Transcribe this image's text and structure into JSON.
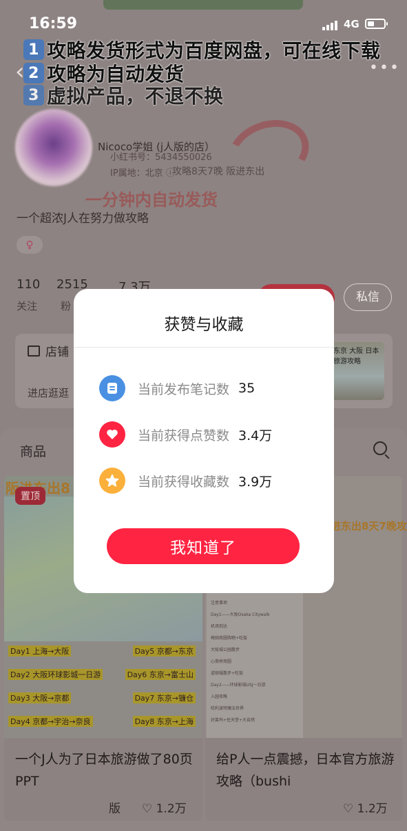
{
  "status_bar": {
    "time": "16:59",
    "network": "4G"
  },
  "promo_lines": [
    "攻略发货形式为百度网盘，可在线下载",
    "攻略为自动发货",
    "虚拟产品，不退不换"
  ],
  "promo_numbers": [
    "1",
    "2",
    "3"
  ],
  "profile": {
    "nickname": "Nicoco学姐 (j人版的店）",
    "red_id": "小红书号：5434550026",
    "ip": "IP属地：北京 ⓘ",
    "overlay_promo": "一分钟内自动发货",
    "overlay_mid": "攻略8天7晚 阪进东出",
    "bio": "一个超浓J人在努力做攻略",
    "gender_symbol": "♀",
    "stats": [
      {
        "value": "110",
        "label": "关注"
      },
      {
        "value": "2515",
        "label": "粉"
      },
      {
        "value": "7.3万",
        "label": ""
      }
    ],
    "message_button": "私信"
  },
  "shop": {
    "title": "店铺",
    "subtitle": "进店逛逛",
    "thumb_text": "东京 大阪 日本旅游攻略"
  },
  "goods_tab": {
    "label": "商品"
  },
  "products": [
    {
      "badge": "置顶",
      "image_banner": "阪进东出8",
      "itinerary": [
        "Day1 上海→大阪",
        "Day2 大阪环球影城一日游",
        "Day3 大阪→京都",
        "Day4 京都→宇治→奈良"
      ],
      "itinerary2": [
        "Day5 京都→东京",
        "Day6 东京→富士山",
        "Day7 东京→镰仓",
        "Day8 东京→上海"
      ],
      "title": "一个J人为了日本旅游做了80页PPT",
      "likes": "1.2万",
      "shop_tag": "版"
    },
    {
      "image_banner": "进东出8天7晚攻",
      "doc_lines": [
        "注意事项",
        "Day1——大阪Osaka Citywalk",
        "机场到达",
        "梅田商圈购物+吃饭",
        "大阪城公园散步",
        "心斋桥商圈",
        "道顿堀散步+吃饭",
        "Day2——环球影城USJ一日游",
        "入园攻略",
        "哈利波特魔法世界",
        "好莱坞+任天堂+大自然"
      ],
      "title": "给P人一点震撼，日本官方旅游攻略（bushi",
      "likes": "1.2万"
    }
  ],
  "modal": {
    "title": "获赞与收藏",
    "rows": [
      {
        "label": "当前发布笔记数",
        "value": "35",
        "color": "#4a90e2",
        "icon": "note-icon"
      },
      {
        "label": "当前获得点赞数",
        "value": "3.4万",
        "color": "#ff2442",
        "icon": "heart-icon"
      },
      {
        "label": "当前获得收藏数",
        "value": "3.9万",
        "color": "#fbb03b",
        "icon": "star-icon"
      }
    ],
    "button": "我知道了"
  }
}
